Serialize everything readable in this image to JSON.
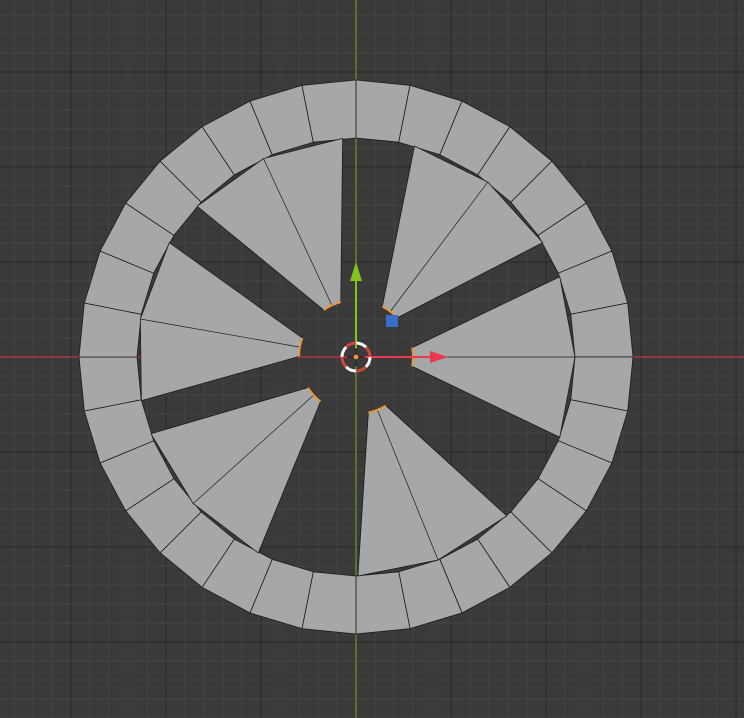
{
  "viewport": {
    "background_color": "#3a3a3a",
    "grid_minor_color": "#444444",
    "grid_major_color": "#2c2c2c",
    "x_axis_color": "#c8364a",
    "y_axis_color": "#6e9a2a"
  },
  "mesh": {
    "object": "wheel",
    "face_color": "#a6a7a9",
    "edge_color": "#1c1c1c",
    "selected_edge_color": "#e8973a",
    "rim_segments": 32,
    "spoke_count": 6,
    "spoke_angles_deg": [
      0,
      53,
      115,
      170,
      222,
      292
    ]
  },
  "gizmos": {
    "transform_x_color": "#e8394f",
    "transform_y_color": "#80c41c",
    "transform_z_color": "#3b6ec7",
    "cursor_icon": "3d-cursor-icon",
    "origin_icon": "object-origin-icon"
  }
}
